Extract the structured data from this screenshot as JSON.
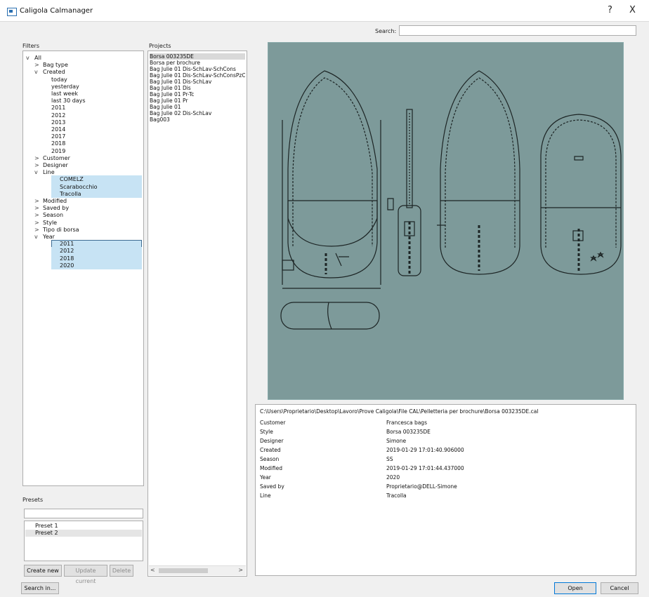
{
  "window": {
    "title": "Caligola Calmanager",
    "help_label": "?",
    "close_label": "X"
  },
  "search": {
    "label": "Search:",
    "value": ""
  },
  "filters": {
    "label": "Filters",
    "tree": [
      {
        "text": "All",
        "arrow": "v",
        "level": 0,
        "selected": false
      },
      {
        "text": "Bag type",
        "arrow": ">",
        "level": 1,
        "selected": false
      },
      {
        "text": "Created",
        "arrow": "v",
        "level": 1,
        "selected": false
      },
      {
        "text": "today",
        "arrow": "",
        "level": 2,
        "selected": false
      },
      {
        "text": "yesterday",
        "arrow": "",
        "level": 2,
        "selected": false
      },
      {
        "text": "last week",
        "arrow": "",
        "level": 2,
        "selected": false
      },
      {
        "text": "last 30 days",
        "arrow": "",
        "level": 2,
        "selected": false
      },
      {
        "text": "2011",
        "arrow": "",
        "level": 2,
        "selected": false
      },
      {
        "text": "2012",
        "arrow": "",
        "level": 2,
        "selected": false
      },
      {
        "text": "2013",
        "arrow": "",
        "level": 2,
        "selected": false
      },
      {
        "text": "2014",
        "arrow": "",
        "level": 2,
        "selected": false
      },
      {
        "text": "2017",
        "arrow": "",
        "level": 2,
        "selected": false
      },
      {
        "text": "2018",
        "arrow": "",
        "level": 2,
        "selected": false
      },
      {
        "text": "2019",
        "arrow": "",
        "level": 2,
        "selected": false
      },
      {
        "text": "Customer",
        "arrow": ">",
        "level": 1,
        "selected": false
      },
      {
        "text": "Designer",
        "arrow": ">",
        "level": 1,
        "selected": false
      },
      {
        "text": "Line",
        "arrow": "v",
        "level": 1,
        "selected": false
      },
      {
        "text": "COMELZ",
        "arrow": "",
        "level": 2,
        "selected": true
      },
      {
        "text": "Scarabocchio",
        "arrow": "",
        "level": 2,
        "selected": true
      },
      {
        "text": "Tracolla",
        "arrow": "",
        "level": 2,
        "selected": true
      },
      {
        "text": "Modified",
        "arrow": ">",
        "level": 1,
        "selected": false
      },
      {
        "text": "Saved by",
        "arrow": ">",
        "level": 1,
        "selected": false
      },
      {
        "text": "Season",
        "arrow": ">",
        "level": 1,
        "selected": false
      },
      {
        "text": "Style",
        "arrow": ">",
        "level": 1,
        "selected": false
      },
      {
        "text": "Tipo di borsa",
        "arrow": ">",
        "level": 1,
        "selected": false
      },
      {
        "text": "Year",
        "arrow": "v",
        "level": 1,
        "selected": false
      },
      {
        "text": "2011",
        "arrow": "",
        "level": 2,
        "selected": true,
        "focused": true
      },
      {
        "text": "2012",
        "arrow": "",
        "level": 2,
        "selected": true
      },
      {
        "text": "2018",
        "arrow": "",
        "level": 2,
        "selected": true
      },
      {
        "text": "2020",
        "arrow": "",
        "level": 2,
        "selected": true
      }
    ]
  },
  "presets": {
    "label": "Presets",
    "name_value": "",
    "items": [
      "Preset 1",
      "Preset 2"
    ],
    "create_label": "Create new",
    "update_label": "Update current",
    "delete_label": "Delete"
  },
  "projects": {
    "label": "Projects",
    "items": [
      "Borsa 003235DE",
      "Borsa per brochure",
      "Bag Julie 01 Dis-SchLav-SchCons",
      "Bag Julie 01 Dis-SchLav-SchConsPzC",
      "Bag Julie 01 Dis-SchLav",
      "Bag Julie 01 Dis",
      "Bag Julie 01 Pr-Tc",
      "Bag Julie 01 Pr",
      "Bag Julie 01",
      "Bag Julie 02 Dis-SchLav",
      "Bag003"
    ],
    "selected_index": 0,
    "scroll_left": "<",
    "scroll_right": ">"
  },
  "details": {
    "path": "C:\\Users\\Proprietario\\Desktop\\Lavoro\\Prove Caligola\\File CAL\\Pelletteria per brochure\\Borsa 003235DE.cal",
    "rows": [
      {
        "key": "Customer",
        "value": "Francesca bags"
      },
      {
        "key": "Style",
        "value": "Borsa 003235DE"
      },
      {
        "key": "Designer",
        "value": "Simone"
      },
      {
        "key": "Created",
        "value": "2019-01-29 17:01:40.906000"
      },
      {
        "key": "Season",
        "value": "SS"
      },
      {
        "key": "Modified",
        "value": "2019-01-29 17:01:44.437000"
      },
      {
        "key": "Year",
        "value": "2020"
      },
      {
        "key": "Saved by",
        "value": "Proprietario@DELL-Simone"
      },
      {
        "key": "Line",
        "value": "Tracolla"
      }
    ]
  },
  "footer": {
    "search_in_label": "Search in...",
    "open_label": "Open",
    "cancel_label": "Cancel"
  },
  "colors": {
    "selection": "#c7e3f4",
    "preview_bg": "#7d9a9a",
    "accent": "#0078d7"
  }
}
